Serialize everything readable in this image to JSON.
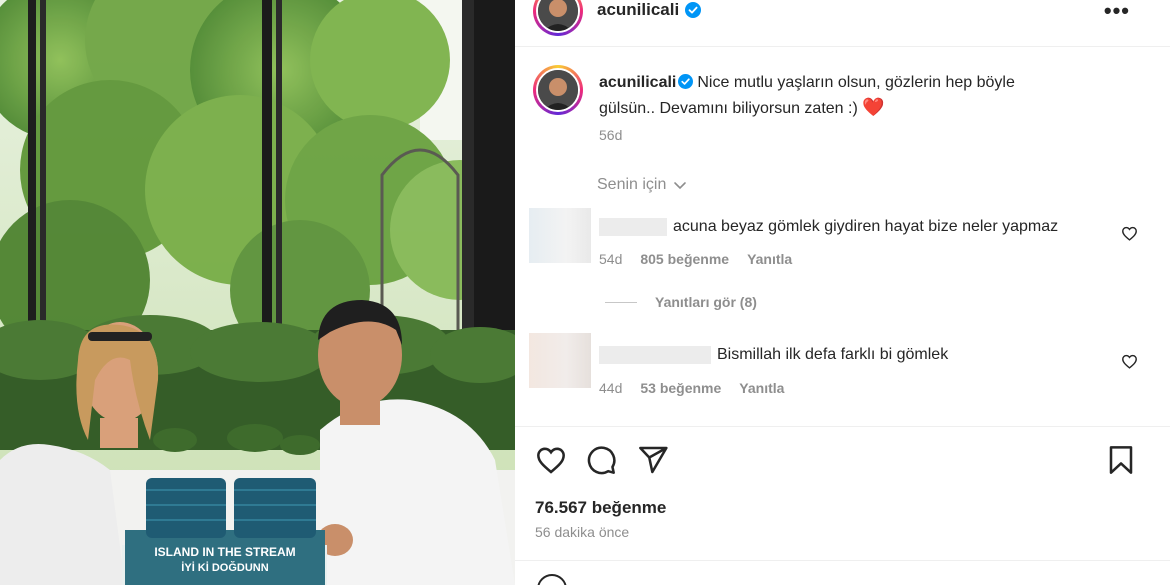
{
  "post": {
    "username": "acunilicali",
    "more_icon": "more-horizontal-icon",
    "verified_color": "#0095f6"
  },
  "caption": {
    "username": "acunilicali",
    "text": "Nice mutlu yaşların olsun, gözlerin hep böyle gülsün.. Devamını biliyorsun zaten :)",
    "emoji": "❤️",
    "time": "56d"
  },
  "sort": {
    "label": "Senin için",
    "icon": "chevron-down-icon"
  },
  "comments": [
    {
      "text": "acuna beyaz gömlek giydiren hayat bize neler yapmaz",
      "time": "54d",
      "likes": "805 beğenme",
      "reply": "Yanıtla"
    },
    {
      "text": "Bismillah ilk defa farklı bi gömlek",
      "time": "44d",
      "likes": "53 beğenme",
      "reply": "Yanıtla"
    }
  ],
  "view_replies": "Yanıtları gör (8)",
  "actions": {
    "icons": [
      "heart-icon",
      "comment-icon",
      "share-icon",
      "bookmark-icon"
    ]
  },
  "likes_total": "76.567 beğenme",
  "posted_ago": "56 dakika önce",
  "photo": {
    "cake_text_top": "ISLAND IN THE STREAM",
    "cake_text_bottom": "İYİ Kİ DOĞDUNN"
  }
}
